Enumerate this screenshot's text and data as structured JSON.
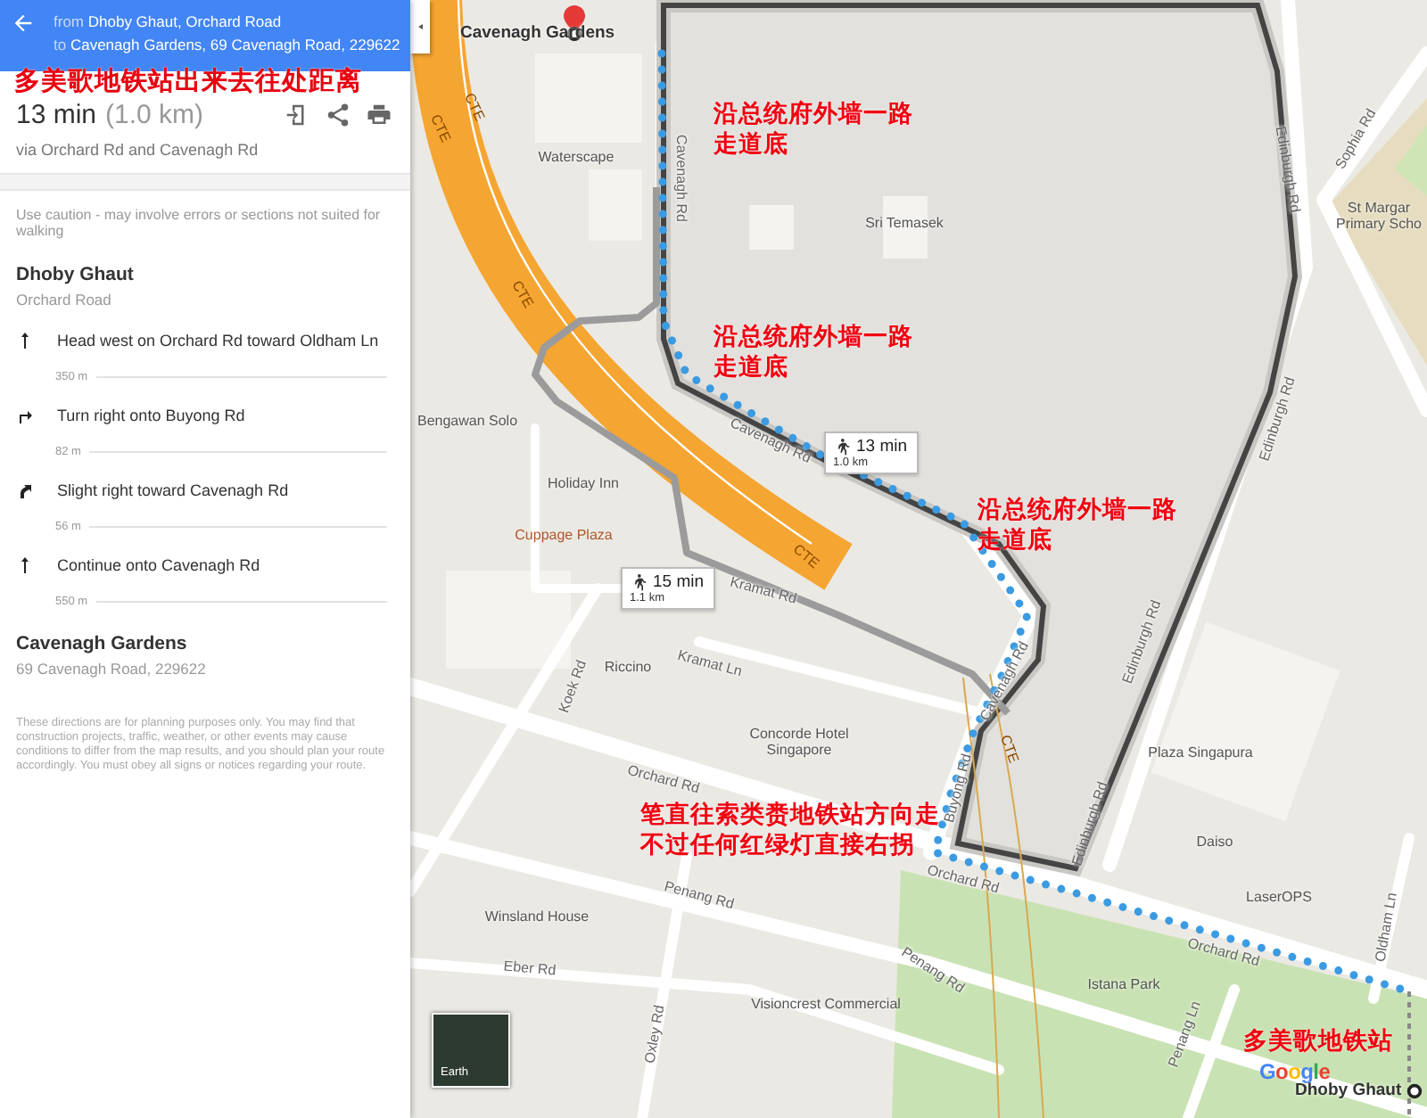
{
  "header": {
    "from_label": "from",
    "from": "Dhoby Ghaut, Orchard Road",
    "to_label": "to",
    "to": "Cavenagh Gardens, 69 Cavenagh Road, 229622"
  },
  "note": "多美歌地铁站出来去往处距离",
  "summary": {
    "duration": "13 min",
    "distance": "(1.0 km)",
    "via": "via Orchard Rd and Cavenagh Rd"
  },
  "caution": "Use caution - may involve errors or sections not suited for walking",
  "origin": {
    "name": "Dhoby Ghaut",
    "address": "Orchard Road"
  },
  "steps": [
    {
      "kind": "straight",
      "text": "Head west on Orchard Rd toward Oldham Ln",
      "distance": "350 m"
    },
    {
      "kind": "turn-right",
      "text": "Turn right onto Buyong Rd",
      "distance": "82 m"
    },
    {
      "kind": "slight-right",
      "text": "Slight right toward Cavenagh Rd",
      "distance": "56 m"
    },
    {
      "kind": "straight",
      "text": "Continue onto Cavenagh Rd",
      "distance": "550 m"
    }
  ],
  "destination": {
    "name": "Cavenagh Gardens",
    "address": "69 Cavenagh Road, 229622"
  },
  "disclaimer": "These directions are for planning purposes only. You may find that construction projects, traffic, weather, or other events may cause conditions to differ from the map results, and you should plan your route accordingly. You must obey all signs or notices regarding your route.",
  "map": {
    "destination_label": "Cavenagh Gardens",
    "origin_label": "Dhoby Ghaut",
    "earth_label": "Earth",
    "logo": "Google",
    "route_cards": [
      {
        "time": "13 min",
        "distance": "1.0 km"
      },
      {
        "time": "15 min",
        "distance": "1.1 km"
      }
    ],
    "labels": [
      {
        "kind": "highway",
        "text": "CTE"
      },
      {
        "kind": "highway",
        "text": "CTE"
      },
      {
        "kind": "place",
        "text": "Waterscape"
      },
      {
        "kind": "road",
        "text": "Cavenagh Rd"
      },
      {
        "kind": "place",
        "text": "Sri Temasek"
      },
      {
        "kind": "road",
        "text": "Sophia Rd"
      },
      {
        "kind": "place",
        "text": "St Margar\nPrimary Scho"
      },
      {
        "kind": "road",
        "text": "Edinburgh Rd"
      },
      {
        "kind": "highway",
        "text": "CTE"
      },
      {
        "kind": "road",
        "text": "Cavenagh Rd"
      },
      {
        "kind": "place",
        "text": "Bengawan Solo"
      },
      {
        "kind": "road",
        "text": "Edinburgh Rd"
      },
      {
        "kind": "place",
        "text": "Holiday Inn"
      },
      {
        "kind": "food",
        "text": "Cuppage Plaza"
      },
      {
        "kind": "highway",
        "text": "CTE"
      },
      {
        "kind": "road",
        "text": "Kramat Rd"
      },
      {
        "kind": "road",
        "text": "Cavenagh Rd"
      },
      {
        "kind": "road",
        "text": "Kramat Ln"
      },
      {
        "kind": "place",
        "text": "Riccino"
      },
      {
        "kind": "road",
        "text": "Koek Rd"
      },
      {
        "kind": "road",
        "text": "Edinburgh Rd"
      },
      {
        "kind": "highway",
        "text": "CTE"
      },
      {
        "kind": "place",
        "text": "Concorde Hotel\nSingapore"
      },
      {
        "kind": "place",
        "text": "Plaza Singapura"
      },
      {
        "kind": "road",
        "text": "Orchard Rd"
      },
      {
        "kind": "road",
        "text": "Buyong Rd"
      },
      {
        "kind": "road",
        "text": "Edinburgh Rd"
      },
      {
        "kind": "place",
        "text": "Daiso"
      },
      {
        "kind": "road",
        "text": "Orchard Rd"
      },
      {
        "kind": "place",
        "text": "LaserOPS"
      },
      {
        "kind": "road",
        "text": "Penang Rd"
      },
      {
        "kind": "road",
        "text": "Oldham Ln"
      },
      {
        "kind": "road",
        "text": "Orchard Rd"
      },
      {
        "kind": "place",
        "text": "Winsland House"
      },
      {
        "kind": "road",
        "text": "Penang Rd"
      },
      {
        "kind": "place",
        "text": "Istana Park"
      },
      {
        "kind": "road",
        "text": "Eber Rd"
      },
      {
        "kind": "place",
        "text": "Visioncrest Commercial"
      },
      {
        "kind": "road",
        "text": "Penang Ln"
      },
      {
        "kind": "road",
        "text": "Oxley Rd"
      }
    ],
    "annotations": [
      {
        "text": "沿总统府外墙一路走道底"
      },
      {
        "text": "沿总统府外墙一路走道底"
      },
      {
        "text": "沿总统府外墙一路走道底"
      },
      {
        "text": "笔直往索类赉地铁站方向走不过任何红绿灯直接右拐"
      },
      {
        "text": "多美歌地铁站"
      }
    ]
  }
}
